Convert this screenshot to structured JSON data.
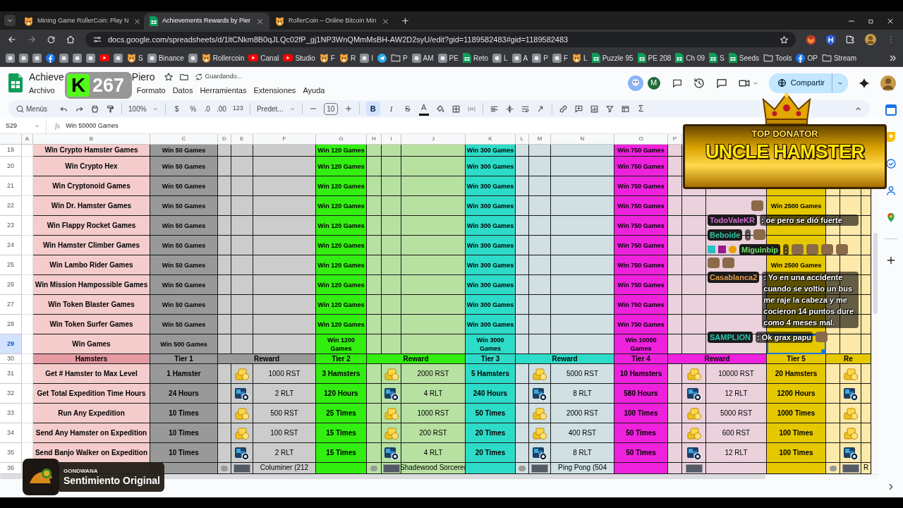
{
  "browser": {
    "tabs": [
      {
        "title": "Mining Game RollerCoin: Play N",
        "selected": false,
        "kind": "hamster"
      },
      {
        "title": "Achievements Rewards by Pier",
        "selected": true,
        "kind": "sheets"
      },
      {
        "title": "RollerCoin – Online Bitcoin Min",
        "selected": false,
        "kind": "hamster"
      }
    ],
    "url": "docs.google.com/spreadsheets/d/1ltCNkm8B0qJLQc02fP_gj1NP3WnQMmMsBH-AW2D2syU/edit?gid=1189582483#gid=1189582483",
    "bookmarks": [
      {
        "kind": "icon"
      },
      {
        "kind": "icon"
      },
      {
        "kind": "icon"
      },
      {
        "kind": "facebook"
      },
      {
        "kind": "icon"
      },
      {
        "kind": "icon"
      },
      {
        "kind": "icon"
      },
      {
        "kind": "youtube"
      },
      {
        "kind": "icon"
      },
      {
        "kind": "hamster",
        "label": "S"
      },
      {
        "kind": "icon",
        "label": "Binance"
      },
      {
        "kind": "icon"
      },
      {
        "kind": "hamster",
        "label": "Rollercoin"
      },
      {
        "kind": "youtube",
        "label": "Canal"
      },
      {
        "kind": "youtube",
        "label": "Studio"
      },
      {
        "kind": "hamster",
        "label": "F"
      },
      {
        "kind": "hamster",
        "label": "R"
      },
      {
        "kind": "icon",
        "label": "I"
      },
      {
        "kind": "telegram"
      },
      {
        "kind": "folder",
        "label": "P"
      },
      {
        "kind": "icon",
        "label": "AM"
      },
      {
        "kind": "icon",
        "label": "PE"
      },
      {
        "kind": "sheets",
        "label": "Reto"
      },
      {
        "kind": "icon",
        "label": "L"
      },
      {
        "kind": "icon",
        "label": "A"
      },
      {
        "kind": "icon",
        "label": "P"
      },
      {
        "kind": "icon",
        "label": "F"
      },
      {
        "kind": "hamster",
        "label": "L"
      },
      {
        "kind": "sheets",
        "label": "Puzzle 95"
      },
      {
        "kind": "sheets",
        "label": "PE 208"
      },
      {
        "kind": "sheets",
        "label": "Ch 09"
      },
      {
        "kind": "sheets",
        "label": "S"
      },
      {
        "kind": "sheets",
        "label": "Seeds"
      },
      {
        "kind": "folder",
        "label": "Tools"
      },
      {
        "kind": "facebook",
        "label": "OP"
      },
      {
        "kind": "folder",
        "label": "Stream"
      }
    ]
  },
  "sheet": {
    "title_start": "Achieve",
    "title_end": "Piero",
    "save_status": "Guardando...",
    "menu": [
      "Archivo",
      "Formato",
      "Datos",
      "Herramientas",
      "Extensiones",
      "Ayuda"
    ],
    "avatar_letter": "M",
    "share_label": "Compartir",
    "toolbar": {
      "search_label": "Menús",
      "zoom": "100%",
      "currency": "$",
      "percent": "%",
      "decrease_decimals": ".0",
      "increase_decimals": ".00",
      "number_format": "123",
      "font": "Predet...",
      "font_size": "10",
      "bold_label": "B",
      "bold_active": true,
      "italic_label": "I",
      "strike_label": "S",
      "text_color_label": "A",
      "functions_label": "Σ"
    },
    "name_box": "S29",
    "function_label": "fx",
    "formula": "Win 50000 Games",
    "columns": [
      "A",
      "B",
      "C",
      "D",
      "E",
      "F",
      "G",
      "H",
      "I",
      "J",
      "K",
      "L",
      "M",
      "N",
      "O",
      "P"
    ],
    "rows": [
      {
        "kind": "goal",
        "number": "19",
        "selected": false,
        "label": "Win Crypto Hamster Games",
        "tiers": [
          "Win 50 Games",
          "Win 120 Games",
          "Win 300 Games",
          "Win 750 Games"
        ]
      },
      {
        "kind": "goal",
        "number": "20",
        "selected": false,
        "label": "Win Crypto Hex",
        "tiers": [
          "Win 50 Games",
          "Win 120 Games",
          "Win 300 Games",
          "Win 750 Games"
        ]
      },
      {
        "kind": "goal",
        "number": "21",
        "selected": false,
        "label": "Win Cryptonoid Games",
        "tiers": [
          "Win 50 Games",
          "Win 120 Games",
          "Win 300 Games",
          "Win 750 Games"
        ]
      },
      {
        "kind": "goal",
        "number": "22",
        "selected": false,
        "label": "Win Dr. Hamster Games",
        "tiers": [
          "Win 50 Games",
          "Win 120 Games",
          "Win 300 Games",
          "Win 750 Games",
          "Win 2500 Games"
        ]
      },
      {
        "kind": "goal",
        "number": "23",
        "selected": false,
        "label": "Win Flappy Rocket Games",
        "tiers": [
          "Win 50 Games",
          "Win 120 Games",
          "Win 300 Games",
          "Win 750 Games"
        ]
      },
      {
        "kind": "goal",
        "number": "24",
        "selected": false,
        "label": "Win Hamster Climber Games",
        "tiers": [
          "Win 50 Games",
          "Win 120 Games",
          "Win 300 Games",
          "Win 750 Games"
        ]
      },
      {
        "kind": "goal",
        "number": "25",
        "selected": false,
        "label": "Win Lambo Rider Games",
        "tiers": [
          "Win 50 Games",
          "Win 120 Games",
          "Win 300 Games",
          "Win 750 Games",
          "Win 2500 Games"
        ]
      },
      {
        "kind": "goal",
        "number": "26",
        "selected": false,
        "label": "Win Mission Hampossible Games",
        "tiers": [
          "Win 50 Games",
          "Win 120 Games",
          "Win 300 Games",
          "Win 750 Games"
        ]
      },
      {
        "kind": "goal",
        "number": "27",
        "selected": false,
        "label": "Win Token Blaster Games",
        "tiers": [
          "Win 50 Games",
          "Win 120 Games",
          "Win 300 Games",
          "Win 750 Games"
        ]
      },
      {
        "kind": "goal",
        "number": "28",
        "selected": false,
        "label": "Win Token Surfer Games",
        "tiers": [
          "Win 50 Games",
          "Win 120 Games",
          "Win 300 Games",
          "Win 750 Games"
        ]
      },
      {
        "kind": "goal",
        "number": "29",
        "selected": true,
        "label": "Win Games",
        "tiers": [
          "Win 500 Games",
          "Win 1200 Games",
          "Win 3000 Games",
          "Win 10000 Games"
        ]
      },
      {
        "kind": "header",
        "number": "30",
        "selected": false,
        "label": "Hamsters",
        "tiers": [
          {
            "label": "Tier 1",
            "reward": "Reward",
            "color": "#999999"
          },
          {
            "label": "Tier 2",
            "reward": "Reward",
            "color": "#33ee11"
          },
          {
            "label": "Tier 3",
            "reward": "Reward",
            "color": "#2ddcc8"
          },
          {
            "label": "Tier 4",
            "reward": "Reward",
            "color": "#ee22dd"
          },
          {
            "label": "Tier 5",
            "reward": "Re",
            "color": "#e6c800"
          }
        ]
      },
      {
        "kind": "reward",
        "number": "31",
        "selected": false,
        "label": "Get # Hamster to Max Level",
        "tiers": [
          {
            "goal": "1 Hamster",
            "kind": "rst",
            "amount": "1000 RST"
          },
          {
            "goal": "3 Hamsters",
            "kind": "rst",
            "amount": "2000 RST"
          },
          {
            "goal": "5 Hamsters",
            "kind": "rst",
            "amount": "5000 RST"
          },
          {
            "goal": "10 Hamsters",
            "kind": "rst",
            "amount": "10000 RST"
          },
          {
            "goal": "20 Hamsters",
            "kind": "rst"
          }
        ]
      },
      {
        "kind": "reward",
        "number": "32",
        "selected": false,
        "label": "Get Total Expedition Time Hours",
        "tiers": [
          {
            "goal": "24 Hours",
            "kind": "rlt",
            "amount": "2 RLT"
          },
          {
            "goal": "120 Hours",
            "kind": "rlt",
            "amount": "4 RLT"
          },
          {
            "goal": "240 Hours",
            "kind": "rlt",
            "amount": "8 RLT"
          },
          {
            "goal": "580 Hours",
            "kind": "rlt",
            "amount": "12 RLT"
          },
          {
            "goal": "1200 Hours",
            "kind": "rlt"
          }
        ]
      },
      {
        "kind": "reward",
        "number": "33",
        "selected": false,
        "label": "Run Any Expedition",
        "tiers": [
          {
            "goal": "10 Times",
            "kind": "rst",
            "amount": "500 RST"
          },
          {
            "goal": "25 Times",
            "kind": "rst",
            "amount": "1000 RST"
          },
          {
            "goal": "50 Times",
            "kind": "rst",
            "amount": "2000 RST"
          },
          {
            "goal": "100 Times",
            "kind": "rst",
            "amount": "5000 RST"
          },
          {
            "goal": "1000 Times",
            "kind": "rst"
          }
        ]
      },
      {
        "kind": "reward",
        "number": "34",
        "selected": false,
        "label": "Send Any Hamster on Expedition",
        "tiers": [
          {
            "goal": "10 Times",
            "kind": "rst",
            "amount": "100 RST"
          },
          {
            "goal": "15 Times",
            "kind": "rst",
            "amount": "200 RST"
          },
          {
            "goal": "20 Times",
            "kind": "rst",
            "amount": "400 RST"
          },
          {
            "goal": "50 Times",
            "kind": "rst",
            "amount": "600 RST"
          },
          {
            "goal": "100 Times",
            "kind": "rst"
          }
        ]
      },
      {
        "kind": "reward",
        "number": "35",
        "selected": false,
        "label": "Send Banjo Walker on Expedition",
        "tiers": [
          {
            "goal": "10 Times",
            "kind": "rlt",
            "amount": "2 RLT"
          },
          {
            "goal": "15 Times",
            "kind": "rlt",
            "amount": "4 RLT"
          },
          {
            "goal": "20 Times",
            "kind": "rlt",
            "amount": "8 RLT"
          },
          {
            "goal": "50 Times",
            "kind": "rlt",
            "amount": "12 RLT"
          },
          {
            "goal": "100 Times",
            "kind": "rlt"
          }
        ]
      },
      {
        "kind": "partial",
        "number": "36",
        "selected": false,
        "tiers": [
          {
            "kind": "miner",
            "amount": "Columiner (212"
          },
          {
            "kind": "miner",
            "amount": "Shadewood Sorcerer"
          },
          {
            "kind": "miner",
            "amount": "Ping Pong (504"
          },
          {
            "kind": "miner"
          },
          {
            "kind": "miner",
            "amount": "R"
          }
        ]
      }
    ]
  },
  "stream_logo": {
    "letter": "K",
    "count": "267"
  },
  "donator_banner": {
    "top_line": "TOP DONATOR",
    "name": "UNCLE HAMSTER"
  },
  "chat": [
    {
      "kind": "emote"
    },
    {
      "kind": "message",
      "user": "TodoValeKR",
      "text": ": oe pero se dió fuerte"
    },
    {
      "kind": "emotes",
      "user": "Beboide",
      "text": ":"
    },
    {
      "kind": "badged_emotes",
      "user": "Miguinbip",
      "text": ":"
    },
    {
      "kind": "message",
      "user": "Casablanca2",
      "text": ": Yo en una accidente cuando se voltio un bus me raje la cabeza y me cocieron 14 puntos dure como 4 meses mal."
    },
    {
      "kind": "message_emote",
      "user": "SAMPLION",
      "text": ": Ok grax papu"
    }
  ],
  "now_playing": {
    "artist": "GONDWANA",
    "title": "Sentimiento Original"
  }
}
